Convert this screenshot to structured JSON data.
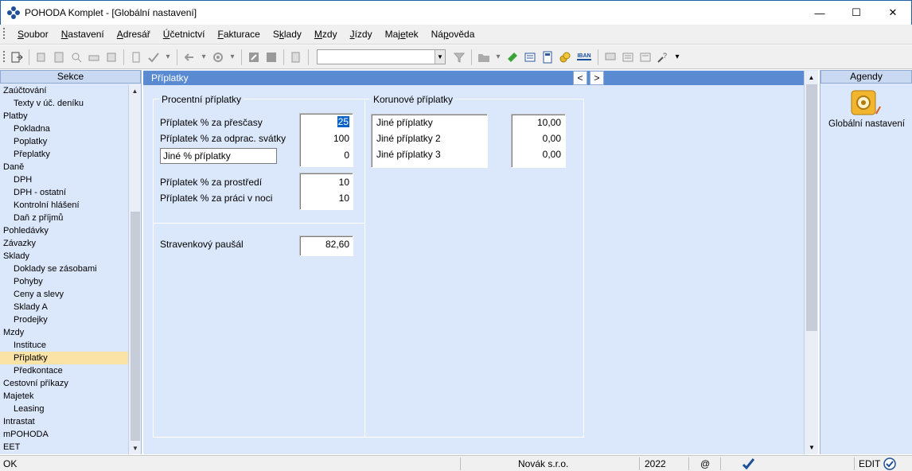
{
  "window": {
    "title": "POHODA Komplet - [Globální nastavení]",
    "minimize_glyph": "—",
    "maximize_glyph": "☐",
    "close_glyph": "✕"
  },
  "menu": [
    {
      "pre": "",
      "u": "S",
      "post": "oubor"
    },
    {
      "pre": "",
      "u": "N",
      "post": "astavení"
    },
    {
      "pre": "",
      "u": "A",
      "post": "dresář"
    },
    {
      "pre": "",
      "u": "Ú",
      "post": "četnictví"
    },
    {
      "pre": "",
      "u": "F",
      "post": "akturace"
    },
    {
      "pre": "S",
      "u": "k",
      "post": "lady"
    },
    {
      "pre": "",
      "u": "M",
      "post": "zdy"
    },
    {
      "pre": "",
      "u": "J",
      "post": "ízdy"
    },
    {
      "pre": "Maj",
      "u": "e",
      "post": "tek"
    },
    {
      "pre": "Ná",
      "u": "p",
      "post": "ověda"
    }
  ],
  "toolbar": {
    "iban_label": "IBAN",
    "search_value": ""
  },
  "sidebar": {
    "header": "Sekce",
    "items": [
      {
        "label": "Zaúčtování",
        "level": 0
      },
      {
        "label": "Texty v úč. deníku",
        "level": 1
      },
      {
        "label": "Platby",
        "level": 0
      },
      {
        "label": "Pokladna",
        "level": 1
      },
      {
        "label": "Poplatky",
        "level": 1
      },
      {
        "label": "Přeplatky",
        "level": 1
      },
      {
        "label": "Daně",
        "level": 0
      },
      {
        "label": "DPH",
        "level": 1
      },
      {
        "label": "DPH - ostatní",
        "level": 1
      },
      {
        "label": "Kontrolní hlášení",
        "level": 1
      },
      {
        "label": "Daň z příjmů",
        "level": 1
      },
      {
        "label": "Pohledávky",
        "level": 0
      },
      {
        "label": "Závazky",
        "level": 0
      },
      {
        "label": "Sklady",
        "level": 0
      },
      {
        "label": "Doklady se zásobami",
        "level": 1
      },
      {
        "label": "Pohyby",
        "level": 1
      },
      {
        "label": "Ceny a slevy",
        "level": 1
      },
      {
        "label": "Sklady A",
        "level": 1
      },
      {
        "label": "Prodejky",
        "level": 1
      },
      {
        "label": "Mzdy",
        "level": 0
      },
      {
        "label": "Instituce",
        "level": 1
      },
      {
        "label": "Příplatky",
        "level": 1,
        "active": true
      },
      {
        "label": "Předkontace",
        "level": 1
      },
      {
        "label": "Cestovní příkazy",
        "level": 0
      },
      {
        "label": "Majetek",
        "level": 0
      },
      {
        "label": "Leasing",
        "level": 1
      },
      {
        "label": "Intrastat",
        "level": 0
      },
      {
        "label": "mPOHODA",
        "level": 0
      },
      {
        "label": "EET",
        "level": 0
      }
    ]
  },
  "main": {
    "header": "Příplatky",
    "prev_glyph": "<",
    "next_glyph": ">",
    "percent_group": {
      "title": "Procentní příplatky",
      "overtime_label": "Příplatek % za přesčasy",
      "overtime_value": "25",
      "holiday_label": "Příplatek % za odprac. svátky",
      "holiday_value": "100",
      "other_label": "Jiné % příplatky",
      "other_value": "0",
      "environment_label": "Příplatek % za prostředí",
      "environment_value": "10",
      "night_label": "Příplatek % za práci v noci",
      "night_value": "10"
    },
    "meal_label": "Stravenkový paušál",
    "meal_value": "82,60",
    "crown_group": {
      "title": "Korunové příplatky",
      "rows": [
        {
          "label": "Jiné příplatky",
          "value": "10,00"
        },
        {
          "label": "Jiné příplatky 2",
          "value": "0,00"
        },
        {
          "label": "Jiné příplatky 3",
          "value": "0,00"
        }
      ]
    }
  },
  "agenda": {
    "header": "Agendy",
    "item_label": "Globální nastavení"
  },
  "status": {
    "state": "OK",
    "company": "Novák s.r.o.",
    "year": "2022",
    "at": "@",
    "mode": "EDIT"
  }
}
